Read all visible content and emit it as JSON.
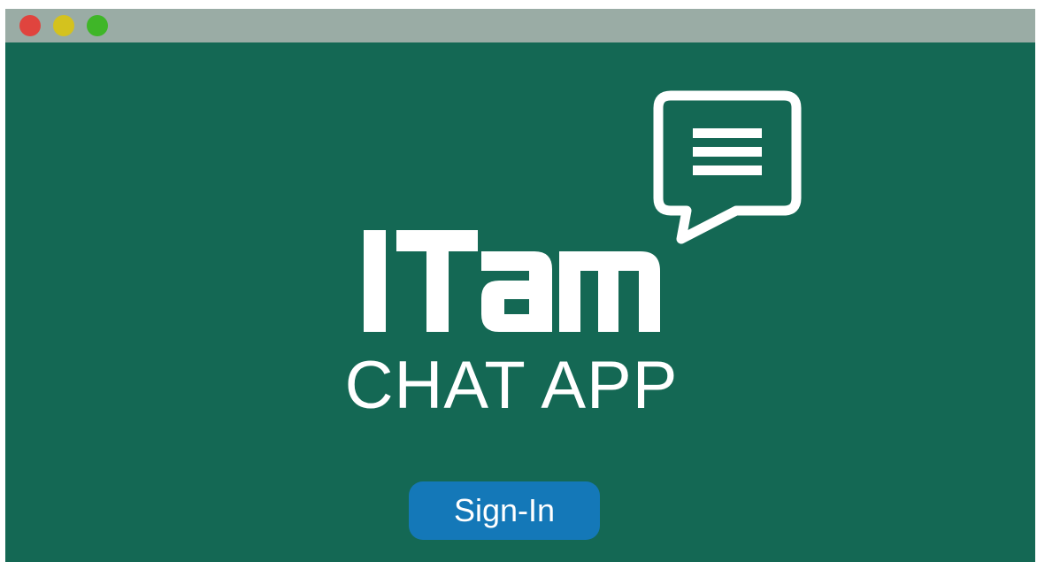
{
  "window": {
    "controls": [
      {
        "name": "close",
        "color": "#e0443e"
      },
      {
        "name": "minimize",
        "color": "#d4c21e"
      },
      {
        "name": "maximize",
        "color": "#3fb628"
      }
    ]
  },
  "colors": {
    "background": "#146854",
    "titlebar": "#9aaca5",
    "button": "#1478b8",
    "text": "#ffffff"
  },
  "logo": {
    "wordmark": "ITAM",
    "icon": "chat-bubble-lines-icon"
  },
  "main": {
    "title": "CHAT APP",
    "signin_label": "Sign-In"
  }
}
